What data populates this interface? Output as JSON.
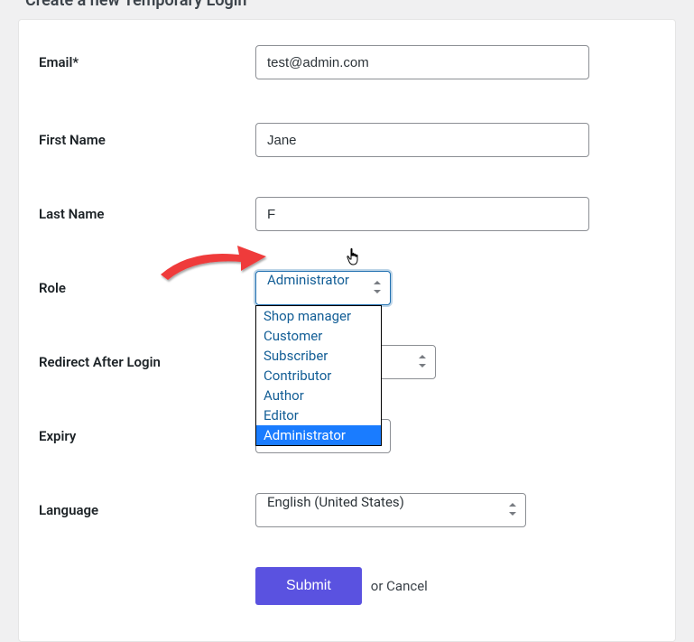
{
  "header": {
    "title": "Create a new Temporary Login"
  },
  "form": {
    "email": {
      "label": "Email*",
      "value": "test@admin.com"
    },
    "first_name": {
      "label": "First Name",
      "value": "Jane"
    },
    "last_name": {
      "label": "Last Name",
      "value": "F"
    },
    "role": {
      "label": "Role",
      "selected": "Administrator",
      "options": [
        "Shop manager",
        "Customer",
        "Subscriber",
        "Contributor",
        "Author",
        "Editor",
        "Administrator"
      ]
    },
    "redirect": {
      "label": "Redirect After Login",
      "selected": ""
    },
    "expiry": {
      "label": "Expiry",
      "selected": ""
    },
    "language": {
      "label": "Language",
      "selected": "English (United States)"
    }
  },
  "actions": {
    "submit": "Submit",
    "or": "or",
    "cancel": "Cancel"
  }
}
